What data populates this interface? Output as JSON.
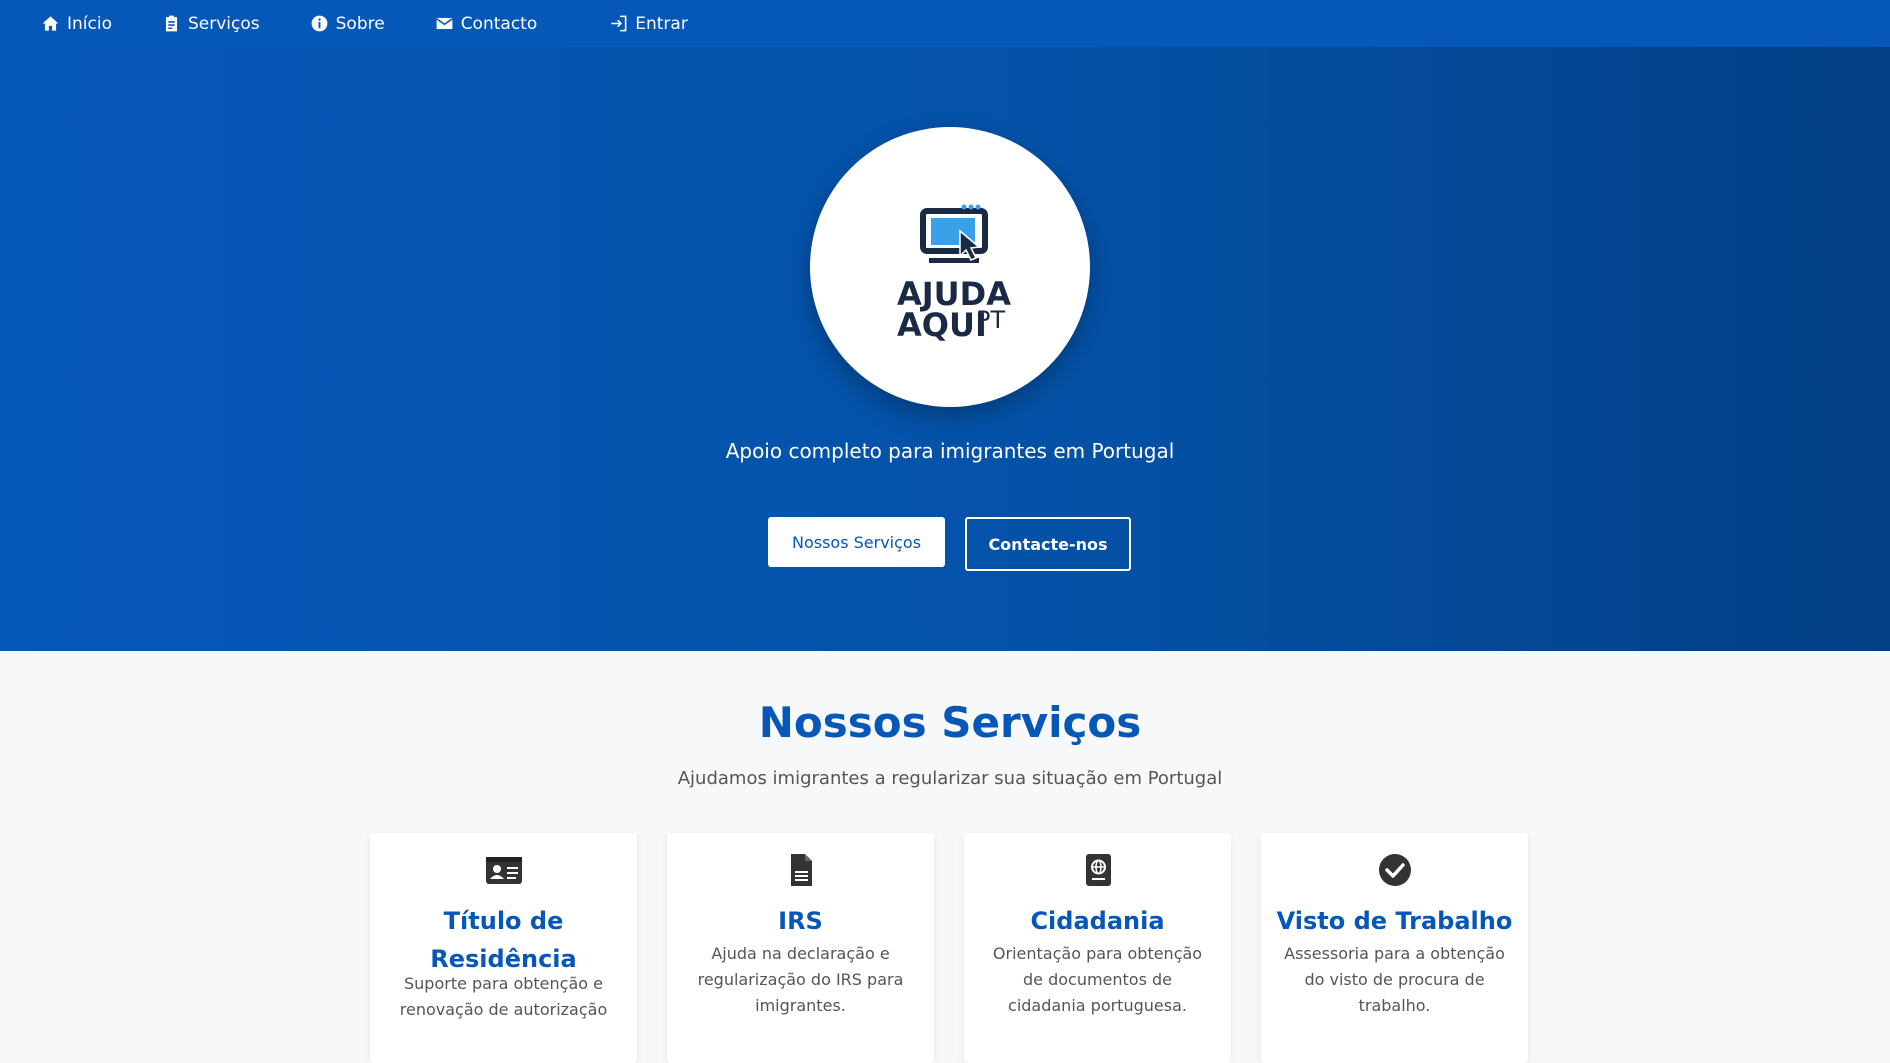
{
  "nav": {
    "items": [
      {
        "label": "Início",
        "icon": "home-icon"
      },
      {
        "label": "Serviços",
        "icon": "clipboard-icon"
      },
      {
        "label": "Sobre",
        "icon": "info-icon"
      },
      {
        "label": "Contacto",
        "icon": "envelope-icon"
      }
    ],
    "login": {
      "label": "Entrar",
      "icon": "sign-in-icon"
    }
  },
  "hero": {
    "logo": {
      "line1": "AJUDA",
      "line2": "AQUI",
      "suffix": "PT"
    },
    "tagline": "Apoio completo para imigrantes em Portugal",
    "primary_button": "Nossos Serviços",
    "secondary_button": "Contacte-nos"
  },
  "services": {
    "title": "Nossos Serviços",
    "subtitle": "Ajudamos imigrantes a regularizar sua situação em Portugal",
    "cards": [
      {
        "icon": "id-card-icon",
        "title": "Título de Residência",
        "text": "Suporte para obtenção e renovação de autorização"
      },
      {
        "icon": "document-icon",
        "title": "IRS",
        "text": "Ajuda na declaração e regularização do IRS para imigrantes."
      },
      {
        "icon": "passport-icon",
        "title": "Cidadania",
        "text": "Orientação para obtenção de documentos de cidadania portuguesa."
      },
      {
        "icon": "check-circle-icon",
        "title": "Visto de Trabalho",
        "text": "Assessoria para a obtenção do visto de procura de trabalho."
      }
    ]
  },
  "colors": {
    "brand_blue": "#0557b8",
    "dark_navy": "#1b2a44",
    "light_blue": "#3aa0e8"
  }
}
